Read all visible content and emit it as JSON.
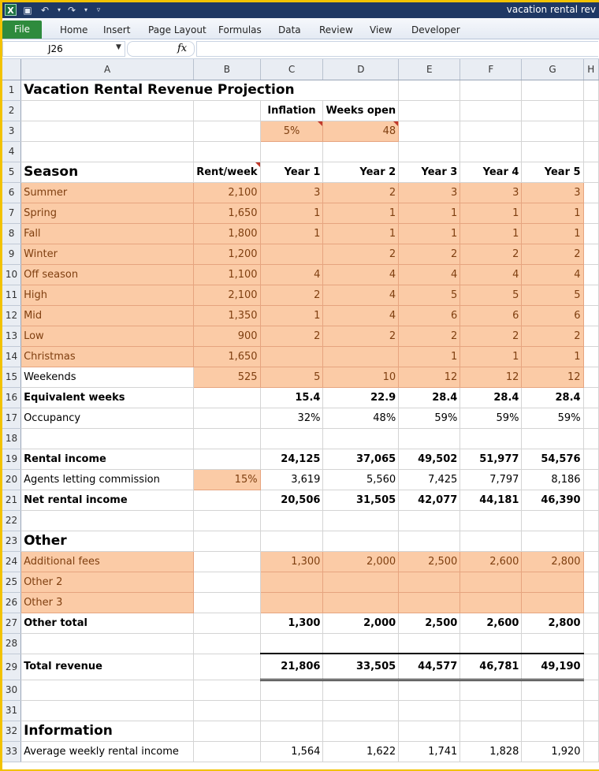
{
  "window": {
    "title": "vacation rental rev",
    "app_icon_letter": "X"
  },
  "ribbon": {
    "file": "File",
    "tabs": [
      "Home",
      "Insert",
      "Page Layout",
      "Formulas",
      "Data",
      "Review",
      "View",
      "Developer"
    ]
  },
  "formula_bar": {
    "name_box": "J26",
    "fx_label": "fx",
    "formula": ""
  },
  "columns": [
    "A",
    "B",
    "C",
    "D",
    "E",
    "F",
    "G",
    "H"
  ],
  "sheet": {
    "title": "Vacation Rental Revenue Projection",
    "inflation_label": "Inflation",
    "weeks_open_label": "Weeks open",
    "inflation": "5%",
    "weeks_open": "48",
    "season_header": "Season",
    "rent_header": "Rent/week",
    "years": [
      "Year 1",
      "Year 2",
      "Year 3",
      "Year 4",
      "Year 5"
    ],
    "seasons": [
      {
        "name": "Summer",
        "rent": "2,100",
        "weeks": [
          "3",
          "2",
          "3",
          "3",
          "3"
        ]
      },
      {
        "name": "Spring",
        "rent": "1,650",
        "weeks": [
          "1",
          "1",
          "1",
          "1",
          "1"
        ]
      },
      {
        "name": "Fall",
        "rent": "1,800",
        "weeks": [
          "1",
          "1",
          "1",
          "1",
          "1"
        ]
      },
      {
        "name": "Winter",
        "rent": "1,200",
        "weeks": [
          "",
          "2",
          "2",
          "2",
          "2"
        ]
      },
      {
        "name": "Off season",
        "rent": "1,100",
        "weeks": [
          "4",
          "4",
          "4",
          "4",
          "4"
        ]
      },
      {
        "name": "High",
        "rent": "2,100",
        "weeks": [
          "2",
          "4",
          "5",
          "5",
          "5"
        ]
      },
      {
        "name": "Mid",
        "rent": "1,350",
        "weeks": [
          "1",
          "4",
          "6",
          "6",
          "6"
        ]
      },
      {
        "name": "Low",
        "rent": "900",
        "weeks": [
          "2",
          "2",
          "2",
          "2",
          "2"
        ]
      },
      {
        "name": "Christmas",
        "rent": "1,650",
        "weeks": [
          "",
          "",
          "1",
          "1",
          "1"
        ]
      }
    ],
    "weekends": {
      "name": "Weekends",
      "rent": "525",
      "values": [
        "5",
        "10",
        "12",
        "12",
        "12"
      ]
    },
    "equivalent_weeks": {
      "label": "Equivalent weeks",
      "values": [
        "15.4",
        "22.9",
        "28.4",
        "28.4",
        "28.4"
      ]
    },
    "occupancy": {
      "label": "Occupancy",
      "values": [
        "32%",
        "48%",
        "59%",
        "59%",
        "59%"
      ]
    },
    "rental_income": {
      "label": "Rental income",
      "values": [
        "24,125",
        "37,065",
        "49,502",
        "51,977",
        "54,576"
      ]
    },
    "commission": {
      "label": "Agents letting commission",
      "rate": "15%",
      "values": [
        "3,619",
        "5,560",
        "7,425",
        "7,797",
        "8,186"
      ]
    },
    "net_rental_income": {
      "label": "Net rental income",
      "values": [
        "20,506",
        "31,505",
        "42,077",
        "44,181",
        "46,390"
      ]
    },
    "other_header": "Other",
    "other_items": [
      {
        "name": "Additional fees",
        "values": [
          "1,300",
          "2,000",
          "2,500",
          "2,600",
          "2,800"
        ]
      },
      {
        "name": "Other 2",
        "values": [
          "",
          "",
          "",
          "",
          ""
        ]
      },
      {
        "name": "Other 3",
        "values": [
          "",
          "",
          "",
          "",
          ""
        ]
      }
    ],
    "other_total": {
      "label": "Other total",
      "values": [
        "1,300",
        "2,000",
        "2,500",
        "2,600",
        "2,800"
      ]
    },
    "total_revenue": {
      "label": "Total revenue",
      "values": [
        "21,806",
        "33,505",
        "44,577",
        "46,781",
        "49,190"
      ]
    },
    "information_header": "Information",
    "avg_weekly": {
      "label": "Average weekly rental income",
      "values": [
        "1,564",
        "1,622",
        "1,741",
        "1,828",
        "1,920"
      ]
    }
  },
  "colors": {
    "input_fill": "#fbcba6",
    "input_text": "#7f3f10",
    "title_bar": "#1f3864",
    "file_tab": "#2e8b3d",
    "window_border": "#f2c200"
  }
}
